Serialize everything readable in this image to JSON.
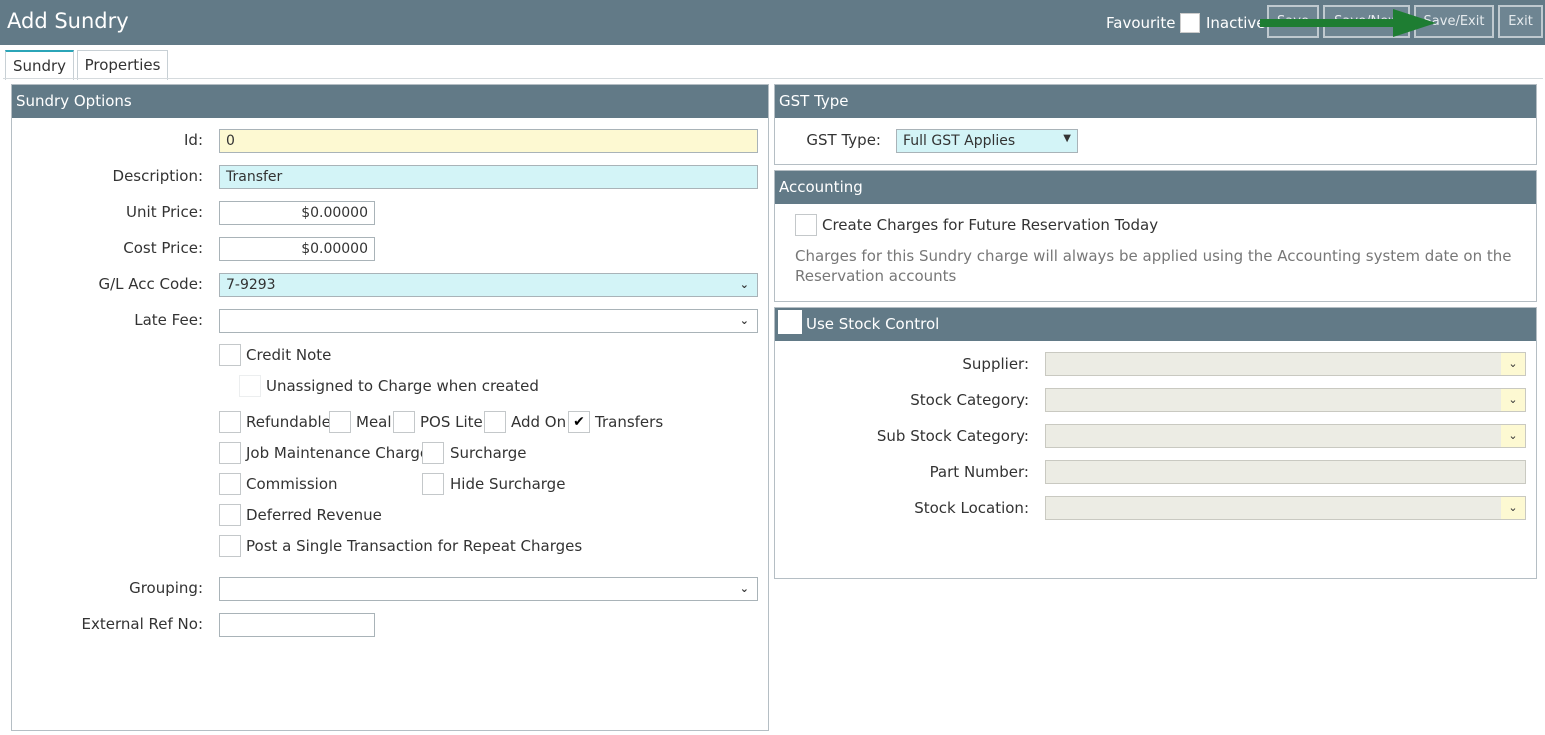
{
  "header": {
    "title": "Add Sundry",
    "favourite_label": "Favourite",
    "inactive_label": "Inactive",
    "buttons": {
      "save": "Save",
      "save_new": "Save/New",
      "save_exit": "Save/Exit",
      "exit": "Exit"
    }
  },
  "tabs": [
    {
      "label": "Sundry"
    },
    {
      "label": "Properties"
    }
  ],
  "sundry_options": {
    "heading": "Sundry Options",
    "id": {
      "label": "Id:",
      "value": "0"
    },
    "description": {
      "label": "Description:",
      "value": "Transfer"
    },
    "unit_price": {
      "label": "Unit Price:",
      "value": "$0.00000"
    },
    "cost_price": {
      "label": "Cost Price:",
      "value": "$0.00000"
    },
    "gl_acc_code": {
      "label": "G/L Acc Code:",
      "value": "7-9293"
    },
    "late_fee": {
      "label": "Late Fee:",
      "value": ""
    },
    "checkboxes": {
      "credit_note": {
        "label": "Credit Note",
        "checked": false
      },
      "unassigned": {
        "label": "Unassigned to Charge when created",
        "checked": false
      },
      "refundable": {
        "label": "Refundable",
        "checked": false
      },
      "meal": {
        "label": "Meal",
        "checked": false
      },
      "pos_lite": {
        "label": "POS Lite",
        "checked": false
      },
      "add_on": {
        "label": "Add On",
        "checked": false
      },
      "transfers": {
        "label": "Transfers",
        "checked": true
      },
      "job_maintenance": {
        "label": "Job Maintenance Charge",
        "checked": false
      },
      "surcharge": {
        "label": "Surcharge",
        "checked": false
      },
      "commission": {
        "label": "Commission",
        "checked": false
      },
      "hide_surcharge": {
        "label": "Hide Surcharge",
        "checked": false
      },
      "deferred_revenue": {
        "label": "Deferred Revenue",
        "checked": false
      },
      "post_single": {
        "label": "Post a Single Transaction for Repeat Charges",
        "checked": false
      }
    },
    "grouping": {
      "label": "Grouping:",
      "value": ""
    },
    "external_ref": {
      "label": "External Ref No:",
      "value": ""
    }
  },
  "gst": {
    "heading": "GST Type",
    "label": "GST Type:",
    "value": "Full GST Applies"
  },
  "accounting": {
    "heading": "Accounting",
    "checkbox_label": "Create Charges for Future Reservation Today",
    "note": "Charges for this Sundry charge will always be applied using the Accounting system date on the Reservation accounts"
  },
  "stock": {
    "heading": "Use Stock Control",
    "supplier": {
      "label": "Supplier:",
      "value": ""
    },
    "stock_category": {
      "label": "Stock Category:",
      "value": ""
    },
    "sub_stock_category": {
      "label": "Sub Stock Category:",
      "value": ""
    },
    "part_number": {
      "label": "Part Number:",
      "value": ""
    },
    "stock_location": {
      "label": "Stock Location:",
      "value": ""
    }
  },
  "colors": {
    "header": "#627a87",
    "arrow": "#1e7d32",
    "required": "#fdf9d2",
    "highlight": "#d3f4f7"
  },
  "check_glyph": "✔",
  "chevron_glyph": "⌄"
}
